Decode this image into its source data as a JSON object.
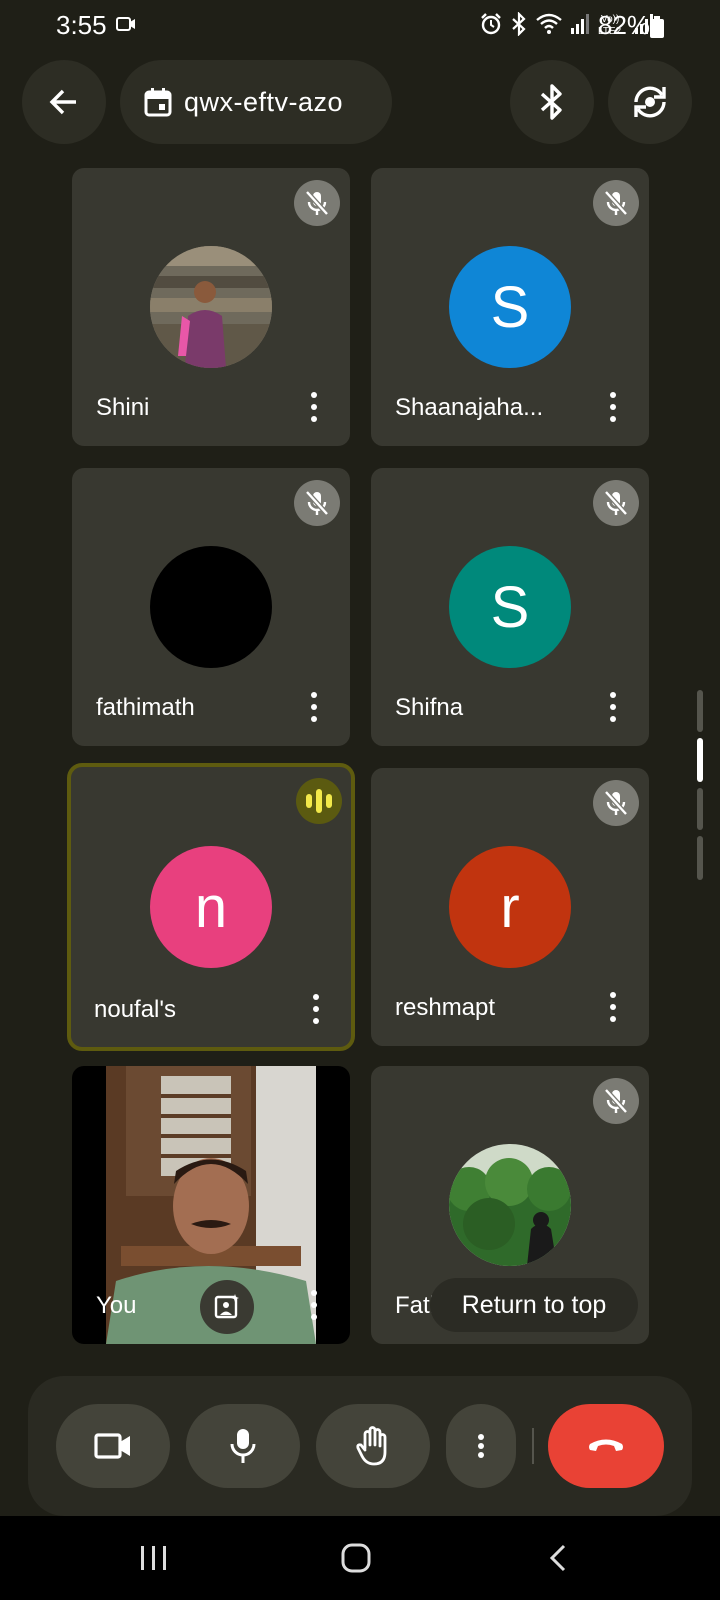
{
  "status_bar": {
    "time": "3:55",
    "battery": "82%",
    "network": "Vo)) LTE2"
  },
  "top_bar": {
    "meeting_code": "qwx-eftv-azo",
    "back_icon": "arrow-left-icon",
    "calendar_icon": "calendar-icon",
    "bluetooth_icon": "bluetooth-icon",
    "switch_camera_icon": "switch-camera-icon"
  },
  "participants": [
    {
      "name": "Shini",
      "avatar_type": "photo",
      "muted": true
    },
    {
      "name": "Shaanajaha...",
      "avatar_letter": "S",
      "avatar_color": "#0f86d6",
      "muted": true
    },
    {
      "name": "fathimath",
      "avatar_type": "black",
      "avatar_color": "#000000",
      "muted": true
    },
    {
      "name": "Shifna",
      "avatar_letter": "S",
      "avatar_color": "#00897b",
      "muted": true
    },
    {
      "name": "noufal's",
      "avatar_letter": "n",
      "avatar_color": "#e8407e",
      "muted": false,
      "speaking": true
    },
    {
      "name": "reshmapt",
      "avatar_letter": "r",
      "avatar_color": "#c1340f",
      "muted": true
    },
    {
      "name": "You",
      "avatar_type": "video",
      "muted": false
    },
    {
      "name": "Fath",
      "avatar_type": "photo",
      "muted": true
    }
  ],
  "return_to_top": "Return to top",
  "controls": {
    "camera_icon": "video-camera-icon",
    "mic_icon": "microphone-icon",
    "raise_hand_icon": "raise-hand-icon",
    "more_icon": "more-vert-icon",
    "end_call_icon": "end-call-icon",
    "end_call_color": "#e94235"
  },
  "colors": {
    "background": "#1f1f17",
    "tile": "#383830",
    "speaking_outline": "#5e5b0f"
  }
}
